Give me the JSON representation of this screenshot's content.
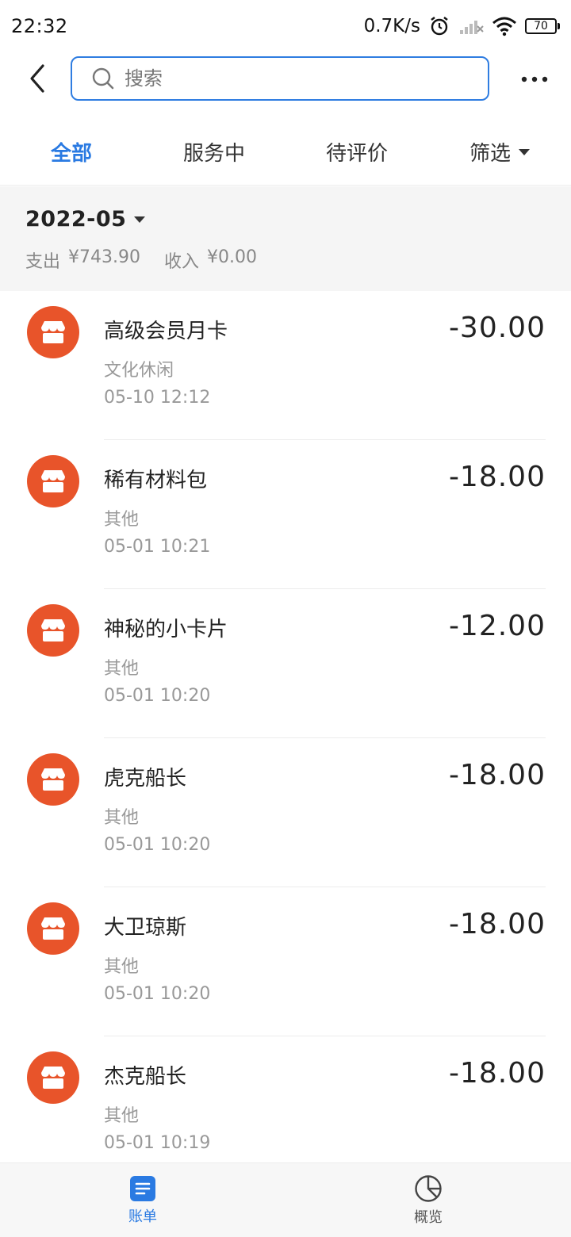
{
  "status_bar": {
    "time": "22:32",
    "network_speed": "0.7K/s",
    "battery_level": "70",
    "icons": [
      "alarm-icon",
      "signal-icon",
      "wifi-icon",
      "battery-icon"
    ]
  },
  "top_bar": {
    "search_placeholder": "搜索",
    "icons": [
      "back-arrow-icon",
      "search-icon",
      "more-icon"
    ],
    "accent_color": "#2f7de1"
  },
  "tabs": [
    {
      "label": "全部",
      "active": true
    },
    {
      "label": "服务中",
      "active": false
    },
    {
      "label": "待评价",
      "active": false
    },
    {
      "label": "筛选",
      "active": false
    }
  ],
  "summary": {
    "month": "2022-05",
    "expense_label": "支出",
    "expense_value": "¥743.90",
    "income_label": "收入",
    "income_value": "¥0.00"
  },
  "transactions": [
    {
      "title": "高级会员月卡",
      "category": "文化休闲",
      "time": "05-10  12:12",
      "amount": "-30.00"
    },
    {
      "title": "稀有材料包",
      "category": "其他",
      "time": "05-01  10:21",
      "amount": "-18.00"
    },
    {
      "title": "神秘的小卡片",
      "category": "其他",
      "time": "05-01  10:20",
      "amount": "-12.00"
    },
    {
      "title": "虎克船长",
      "category": "其他",
      "time": "05-01  10:20",
      "amount": "-18.00"
    },
    {
      "title": "大卫琼斯",
      "category": "其他",
      "time": "05-01  10:20",
      "amount": "-18.00"
    },
    {
      "title": "杰克船长",
      "category": "其他",
      "time": "05-01  10:19",
      "amount": "-18.00"
    }
  ],
  "item_icon": {
    "name": "store-icon",
    "color": "#e8542a"
  },
  "bottom_nav": [
    {
      "label": "账单",
      "icon": "bill-icon",
      "active": true
    },
    {
      "label": "概览",
      "icon": "pie-chart-icon",
      "active": false
    }
  ],
  "active_color": "#2a7ae2"
}
